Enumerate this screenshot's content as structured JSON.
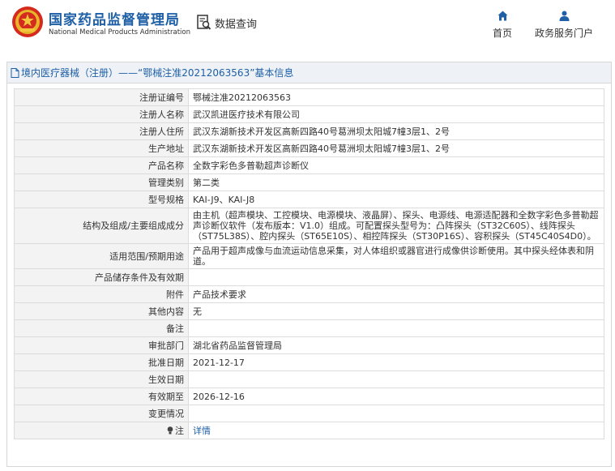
{
  "header": {
    "brand_cn": "国家药品监督管理局",
    "brand_en": "National Medical Products Administration",
    "query_label": "数据查询",
    "nav": [
      {
        "label": "首页",
        "icon": "home-icon"
      },
      {
        "label": "政务服务门户",
        "icon": "user-icon"
      }
    ]
  },
  "panel": {
    "title": "境内医疗器械（注册）——“鄂械注准20212063563”基本信息"
  },
  "rows": [
    {
      "label": "注册证编号",
      "value": "鄂械注准20212063563"
    },
    {
      "label": "注册人名称",
      "value": "武汉凯进医疗技术有限公司"
    },
    {
      "label": "注册人住所",
      "value": "武汉东湖新技术开发区高新四路40号葛洲坝太阳城7幢3层1、2号"
    },
    {
      "label": "生产地址",
      "value": "武汉东湖新技术开发区高新四路40号葛洲坝太阳城7幢3层1、2号"
    },
    {
      "label": "产品名称",
      "value": "全数字彩色多普勒超声诊断仪"
    },
    {
      "label": "管理类别",
      "value": "第二类"
    },
    {
      "label": "型号规格",
      "value": "KAI-J9、KAI-J8"
    },
    {
      "label": "结构及组成/主要组成成分",
      "value": "由主机（超声模块、工控模块、电源模块、液晶屏）、探头、电源线、电源适配器和全数字彩色多普勒超声诊断仪软件（发布版本：V1.0）组成。可配置探头型号为：凸阵探头（ST32C60S）、线阵探头（ST75L38S）、腔内探头（ST65E10S）、相控阵探头（ST30P16S）、容积探头（ST45C40S4D0）。"
    },
    {
      "label": "适用范围/预期用途",
      "value": "产品用于超声成像与血流运动信息采集，对人体组织或器官进行成像供诊断使用。其中探头经体表和阴道。"
    },
    {
      "label": "产品储存条件及有效期",
      "value": ""
    },
    {
      "label": "附件",
      "value": "产品技术要求"
    },
    {
      "label": "其他内容",
      "value": "无"
    },
    {
      "label": "备注",
      "value": ""
    },
    {
      "label": "审批部门",
      "value": "湖北省药品监督管理局"
    },
    {
      "label": "批准日期",
      "value": "2021-12-17"
    },
    {
      "label": "生效日期",
      "value": ""
    },
    {
      "label": "有效期至",
      "value": "2026-12-16"
    },
    {
      "label": "变更情况",
      "value": ""
    },
    {
      "label": "注",
      "value": "详情",
      "icon": "bulb-icon"
    }
  ]
}
